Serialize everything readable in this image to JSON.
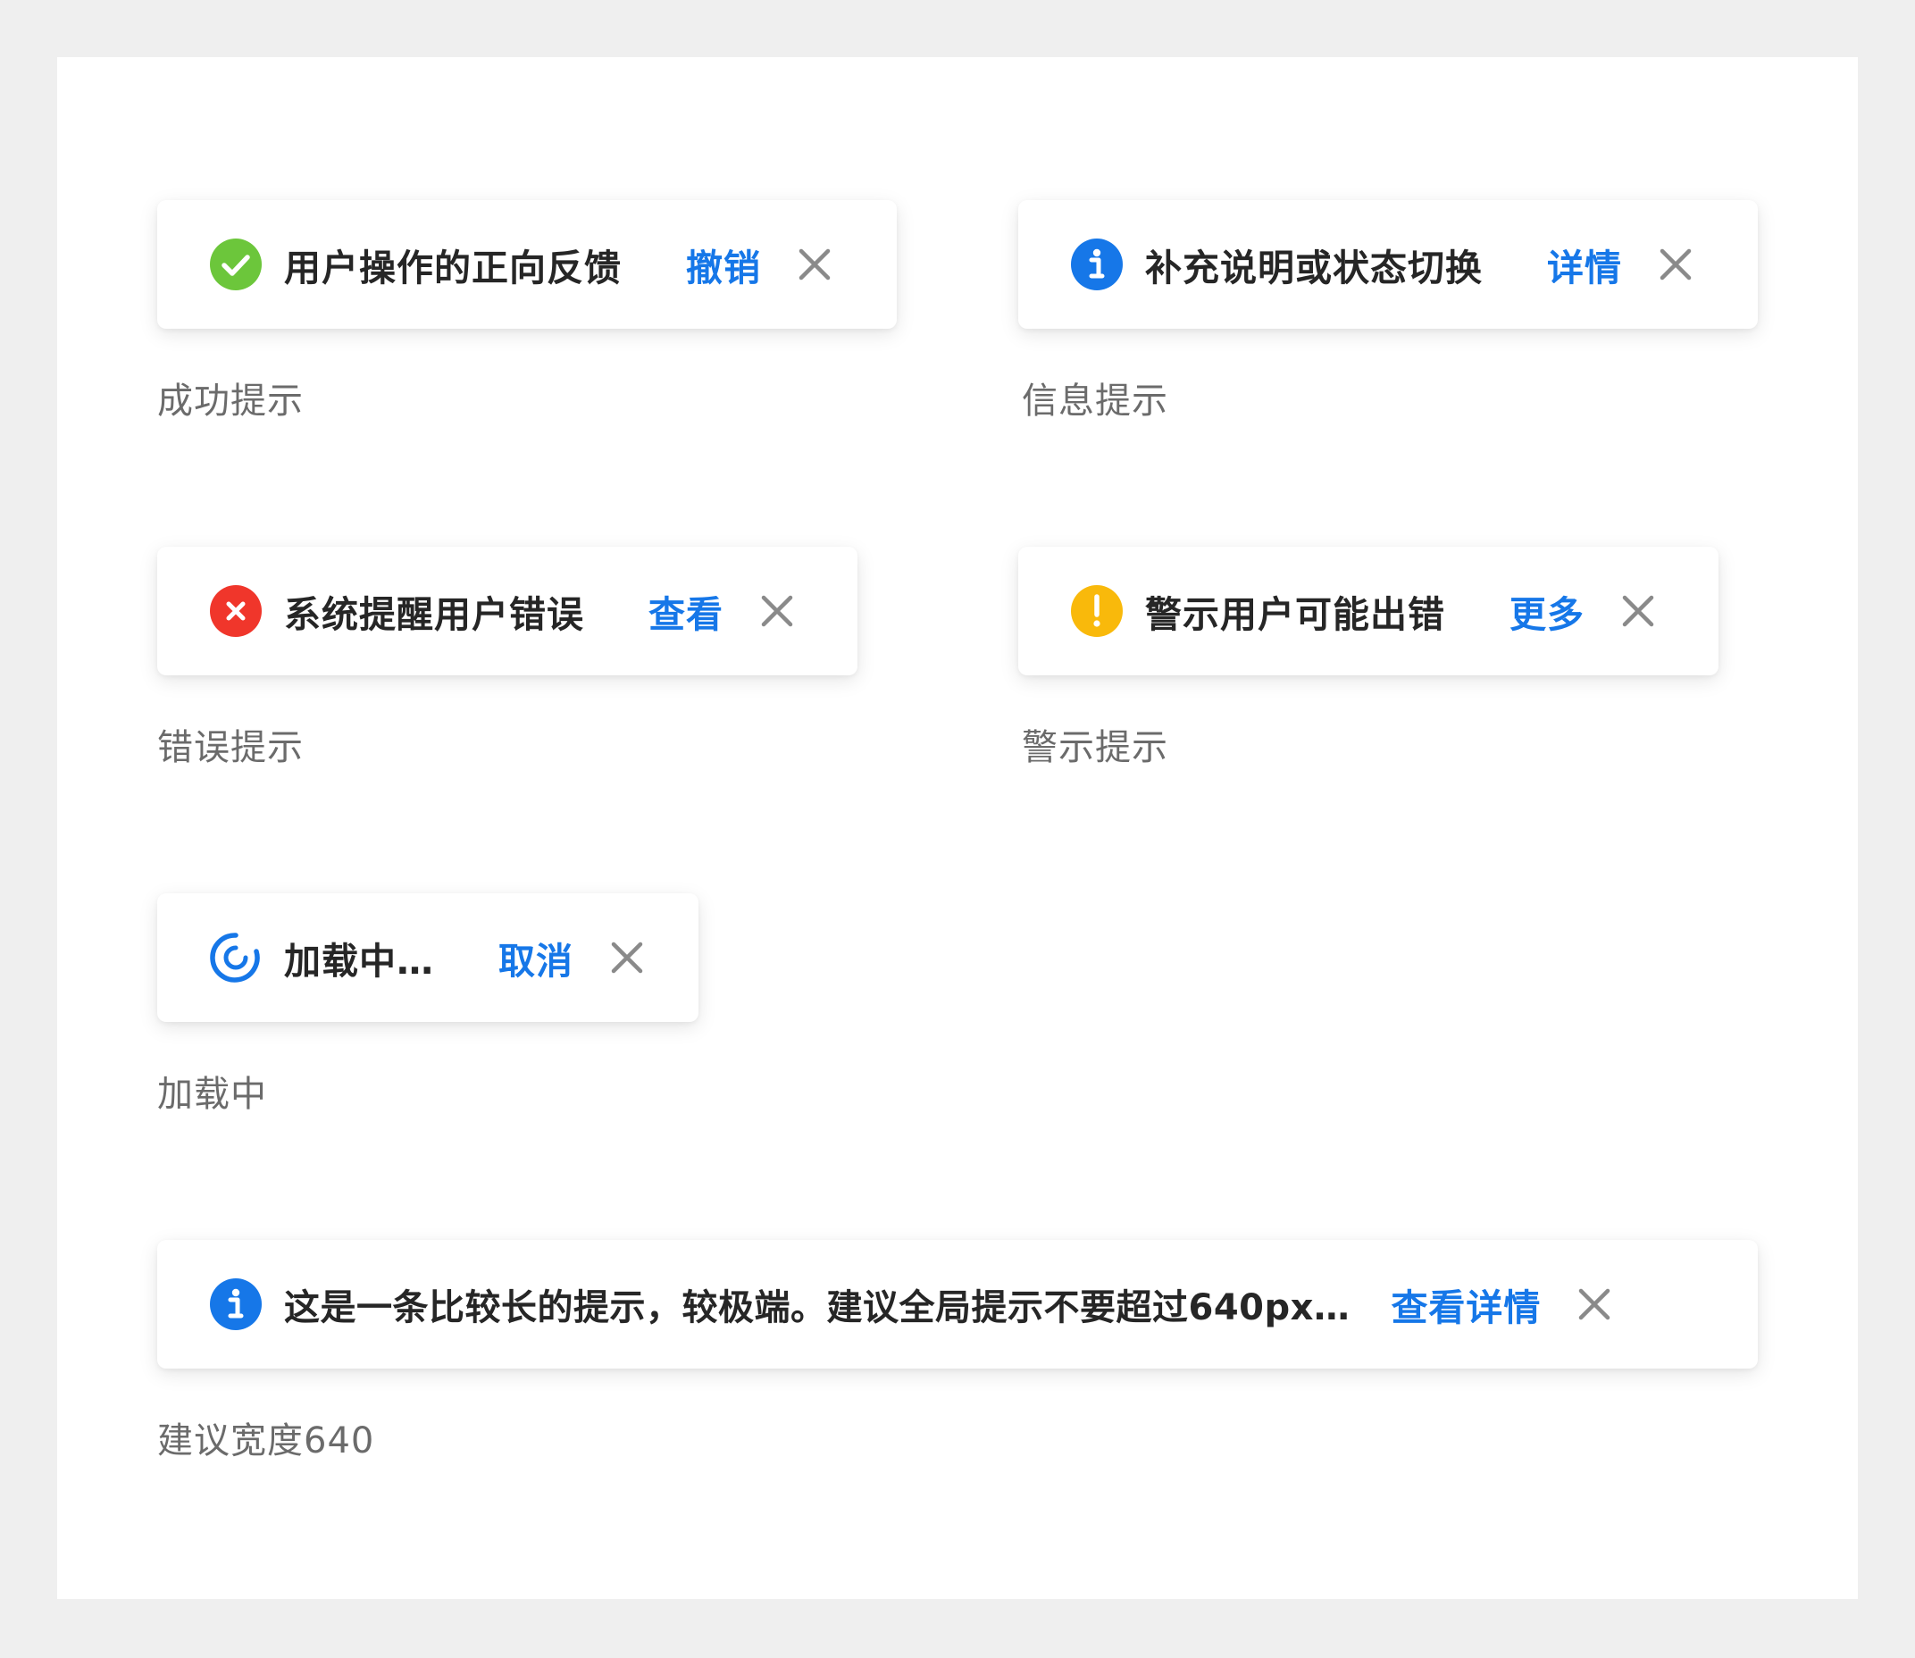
{
  "colors": {
    "success": "#6cc63b",
    "info": "#1677e8",
    "error": "#f0362b",
    "warning": "#f9b90b",
    "loading": "#1677e8",
    "action": "#1677e8",
    "close": "#8a8a8a"
  },
  "toasts": {
    "success": {
      "icon": "check-circle-icon",
      "message": "用户操作的正向反馈",
      "action": "撤销",
      "caption": "成功提示"
    },
    "info": {
      "icon": "info-circle-icon",
      "message": "补充说明或状态切换",
      "action": "详情",
      "caption": "信息提示"
    },
    "error": {
      "icon": "error-circle-icon",
      "message": "系统提醒用户错误",
      "action": "查看",
      "caption": "错误提示"
    },
    "warning": {
      "icon": "warning-circle-icon",
      "message": "警示用户可能出错",
      "action": "更多",
      "caption": "警示提示"
    },
    "loading": {
      "icon": "loading-spinner-icon",
      "message": "加载中…",
      "action": "取消",
      "caption": "加载中"
    },
    "long": {
      "icon": "info-circle-icon",
      "message": "这是一条比较长的提示，较极端。建议全局提示不要超过640px…",
      "action": "查看详情",
      "caption": "建议宽度640"
    }
  }
}
